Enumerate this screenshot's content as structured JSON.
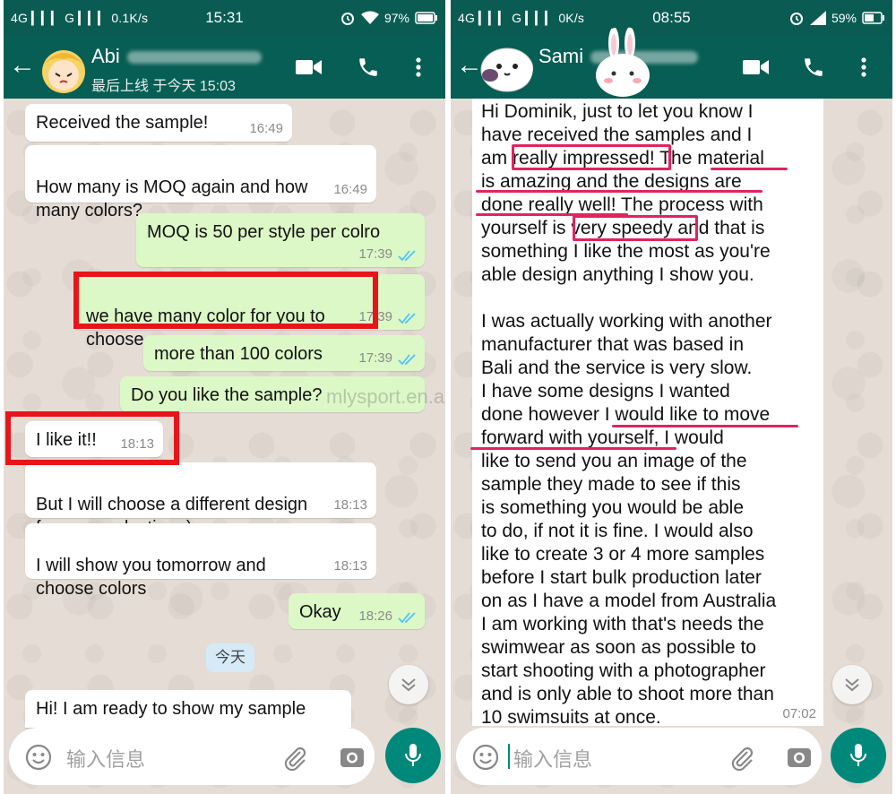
{
  "colors": {
    "header": "#075e54",
    "status_bar": "#0a5c52",
    "incoming": "#ffffff",
    "outgoing": "#dcf8c6",
    "accent": "#00897b",
    "annotation_red": "#e8141a",
    "annotation_pink": "#e0245e"
  },
  "watermark": "mlysport.en.alibaba.com",
  "left": {
    "status": {
      "carrier": "4G ▎▎▎ G ▎▎▎ 0.1K/s",
      "time": "15:31",
      "battery": "97%"
    },
    "header": {
      "name": "Abi",
      "last_seen": "最后上线 于今天 15:03"
    },
    "messages": [
      {
        "text": "Received the sample!",
        "time": "16:49"
      },
      {
        "text": "How many is MOQ again and how\nmany colors?",
        "time": "16:49"
      },
      {
        "text": "MOQ is 50 per style per colro",
        "time": "17:39"
      },
      {
        "text": "we have many color for you to\nchoose",
        "time": "17:39"
      },
      {
        "text": "more than 100 colors",
        "time": "17:39"
      },
      {
        "text": "Do you like the sample?",
        "time": ""
      },
      {
        "text": "I like it!!",
        "time": "18:13"
      },
      {
        "text": "But I will choose a different design\nfor our production :)",
        "time": "18:13"
      },
      {
        "text": "I will show you tomorrow and\nchoose colors",
        "time": "18:13"
      },
      {
        "text": "Okay",
        "time": "18:26"
      },
      {
        "text": "Hi! I am ready to show my sample",
        "time": ""
      }
    ],
    "date_chip": "今天",
    "input_placeholder": "输入信息"
  },
  "right": {
    "status": {
      "carrier": "4G ▎▎▎ G ▎▎▎ 0K/s",
      "time": "08:55",
      "battery": "59%"
    },
    "header": {
      "name": "Sami"
    },
    "message": {
      "p1": "Hi Dominik, just to let you know I\nhave received the samples and I\nam really impressed! The material\nis amazing and the designs are\ndone really well! The process with\nyourself is very speedy and that is\nsomething I like the most as you're\nable design anything I show you.",
      "p2": "I was actually working with another\nmanufacturer that was based in\nBali and the service is very slow.\nI have some designs I wanted\ndone however I would like to move\nforward with yourself, I would\nlike to send you an image of the\nsample they made to see if this\nis something you would be able\nto do, if not it is fine. I would also\nlike to create 3 or 4 more samples\nbefore I start bulk production later\non as I have a model from Australia\nI am working with that's needs the\nswimwear as soon as possible to\nstart shooting with a photographer\nand is only able to shoot more than\n10 swimsuits at once.",
      "time": "07:02"
    },
    "input_placeholder": "输入信息"
  },
  "icons": [
    "back-arrow-icon",
    "video-call-icon",
    "phone-icon",
    "more-vert-icon",
    "emoji-icon",
    "attach-icon",
    "camera-icon",
    "mic-icon",
    "double-check-icon",
    "chevron-double-down-icon",
    "wifi-icon",
    "alarm-icon",
    "signal-icon"
  ]
}
